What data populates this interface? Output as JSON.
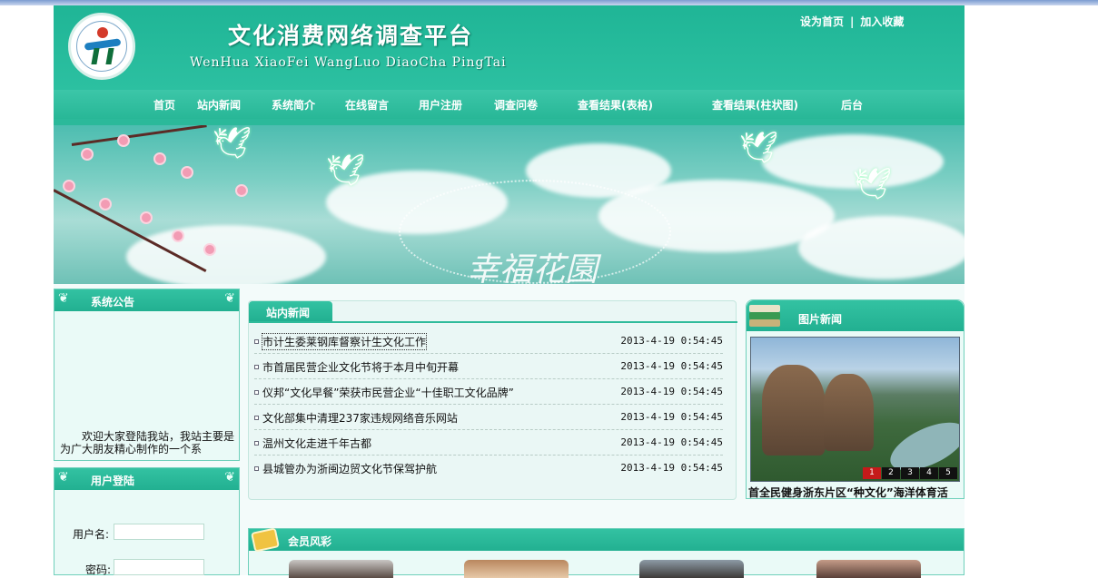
{
  "header": {
    "title": "文化消费网络调查平台",
    "subtitle": "WenHua XiaoFei WangLuo DiaoCha PingTai",
    "links": [
      "设为首页",
      "加入收藏"
    ],
    "link_separator": "|"
  },
  "nav": {
    "items": [
      "首页",
      "站内新闻",
      "系统简介",
      "在线留言",
      "用户注册",
      "调查问卷",
      "查看结果(表格)",
      "查看结果(柱状图)",
      "后台"
    ]
  },
  "banner": {
    "overlay_text": "幸福花園"
  },
  "notice": {
    "title": "系统公告",
    "text": "欢迎大家登陆我站，我站主要是为广大朋友精心制作的一个系"
  },
  "login": {
    "title": "用户登陆",
    "username_label": "用户名:",
    "password_label": "密码:",
    "username_value": "",
    "password_value": ""
  },
  "news": {
    "tab": "站内新闻",
    "items": [
      {
        "title": "市计生委莱钢库督察计生文化工作",
        "date": "2013-4-19 0:54:45"
      },
      {
        "title": "市首届民营企业文化节将于本月中旬开幕",
        "date": "2013-4-19 0:54:45"
      },
      {
        "title": "仪邦“文化早餐”荣获市民营企业“十佳职工文化品牌”",
        "date": "2013-4-19 0:54:45"
      },
      {
        "title": "文化部集中清理237家违规网络音乐网站",
        "date": "2013-4-19 0:54:45"
      },
      {
        "title": "温州文化走进千年古都",
        "date": "2013-4-19 0:54:45"
      },
      {
        "title": "县城管办为浙闽边贸文化节保驾护航",
        "date": "2013-4-19 0:54:45"
      }
    ]
  },
  "picture_news": {
    "title": "图片新闻",
    "caption": "首全民健身浙东片区“种文化”海洋体育活",
    "pages": [
      "1",
      "2",
      "3",
      "4",
      "5"
    ],
    "active_page": "1"
  },
  "members": {
    "title": "会员风彩"
  },
  "colors": {
    "primary": "#22b091",
    "active_page": "#c51a1a"
  }
}
